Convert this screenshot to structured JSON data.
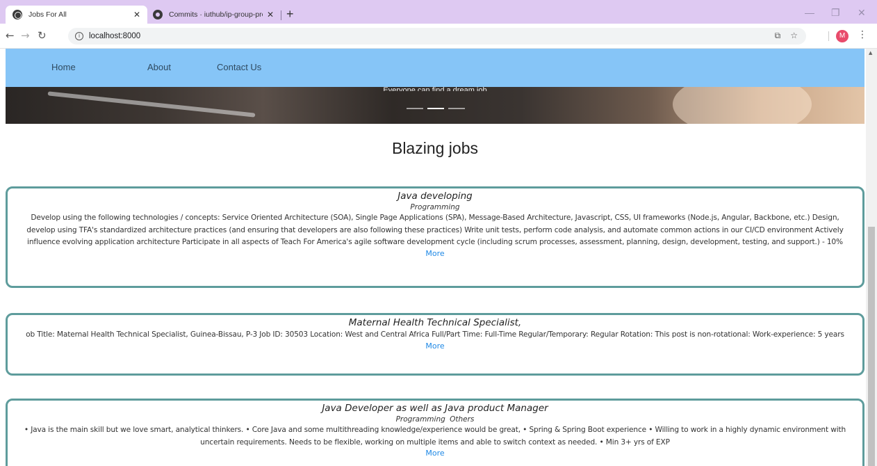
{
  "browser": {
    "tabs": [
      {
        "title": "Jobs For All",
        "active": true
      },
      {
        "title": "Commits · iuthub/ip-group-proje",
        "active": false
      }
    ],
    "new_tab_label": "+",
    "url": "localhost:8000",
    "profile_initial": "M"
  },
  "navbar": {
    "links": [
      "Home",
      "About",
      "Contact Us"
    ]
  },
  "hero": {
    "caption": "Everyone can find a dream job",
    "indicators": 3,
    "active_indicator": 1
  },
  "section": {
    "title": "Blazing jobs"
  },
  "jobs": [
    {
      "title": "Java developing",
      "category": "Programming",
      "description": "Develop using the following technologies / concepts: Service Oriented Architecture (SOA), Single Page Applications (SPA), Message-Based Architecture, Javascript, CSS, UI frameworks (Node.js, Angular, Backbone, etc.) Design, develop using TFA's standardized architecture practices (and ensuring that developers are also following these practices) Write unit tests, perform code analysis, and automate common actions in our CI/CD environment Actively influence evolving application architecture Participate in all aspects of Teach For America's agile software development cycle (including scrum processes, assessment, planning, design, development, testing, and support.) - 10%",
      "more_label": "More"
    },
    {
      "title": "Maternal Health Technical Specialist,",
      "category": "",
      "description": "ob Title: Maternal Health Technical Specialist, Guinea-Bissau, P-3 Job ID: 30503 Location: West and Central Africa Full/Part Time: Full-Time Regular/Temporary: Regular Rotation: This post is non-rotational: Work-experience: 5 years",
      "more_label": "More"
    },
    {
      "title": "Java Developer as well as Java product Manager",
      "category": "Programming  Others",
      "description": "• Java is the main skill but we love smart, analytical thinkers. • Core Java and some multithreading knowledge/experience would be great, • Spring & Spring Boot experience • Willing to work in a highly dynamic environment with uncertain requirements. Needs to be flexible, working on multiple items and able to switch context as needed. • Min 3+ yrs of EXP",
      "more_label": "More"
    }
  ]
}
